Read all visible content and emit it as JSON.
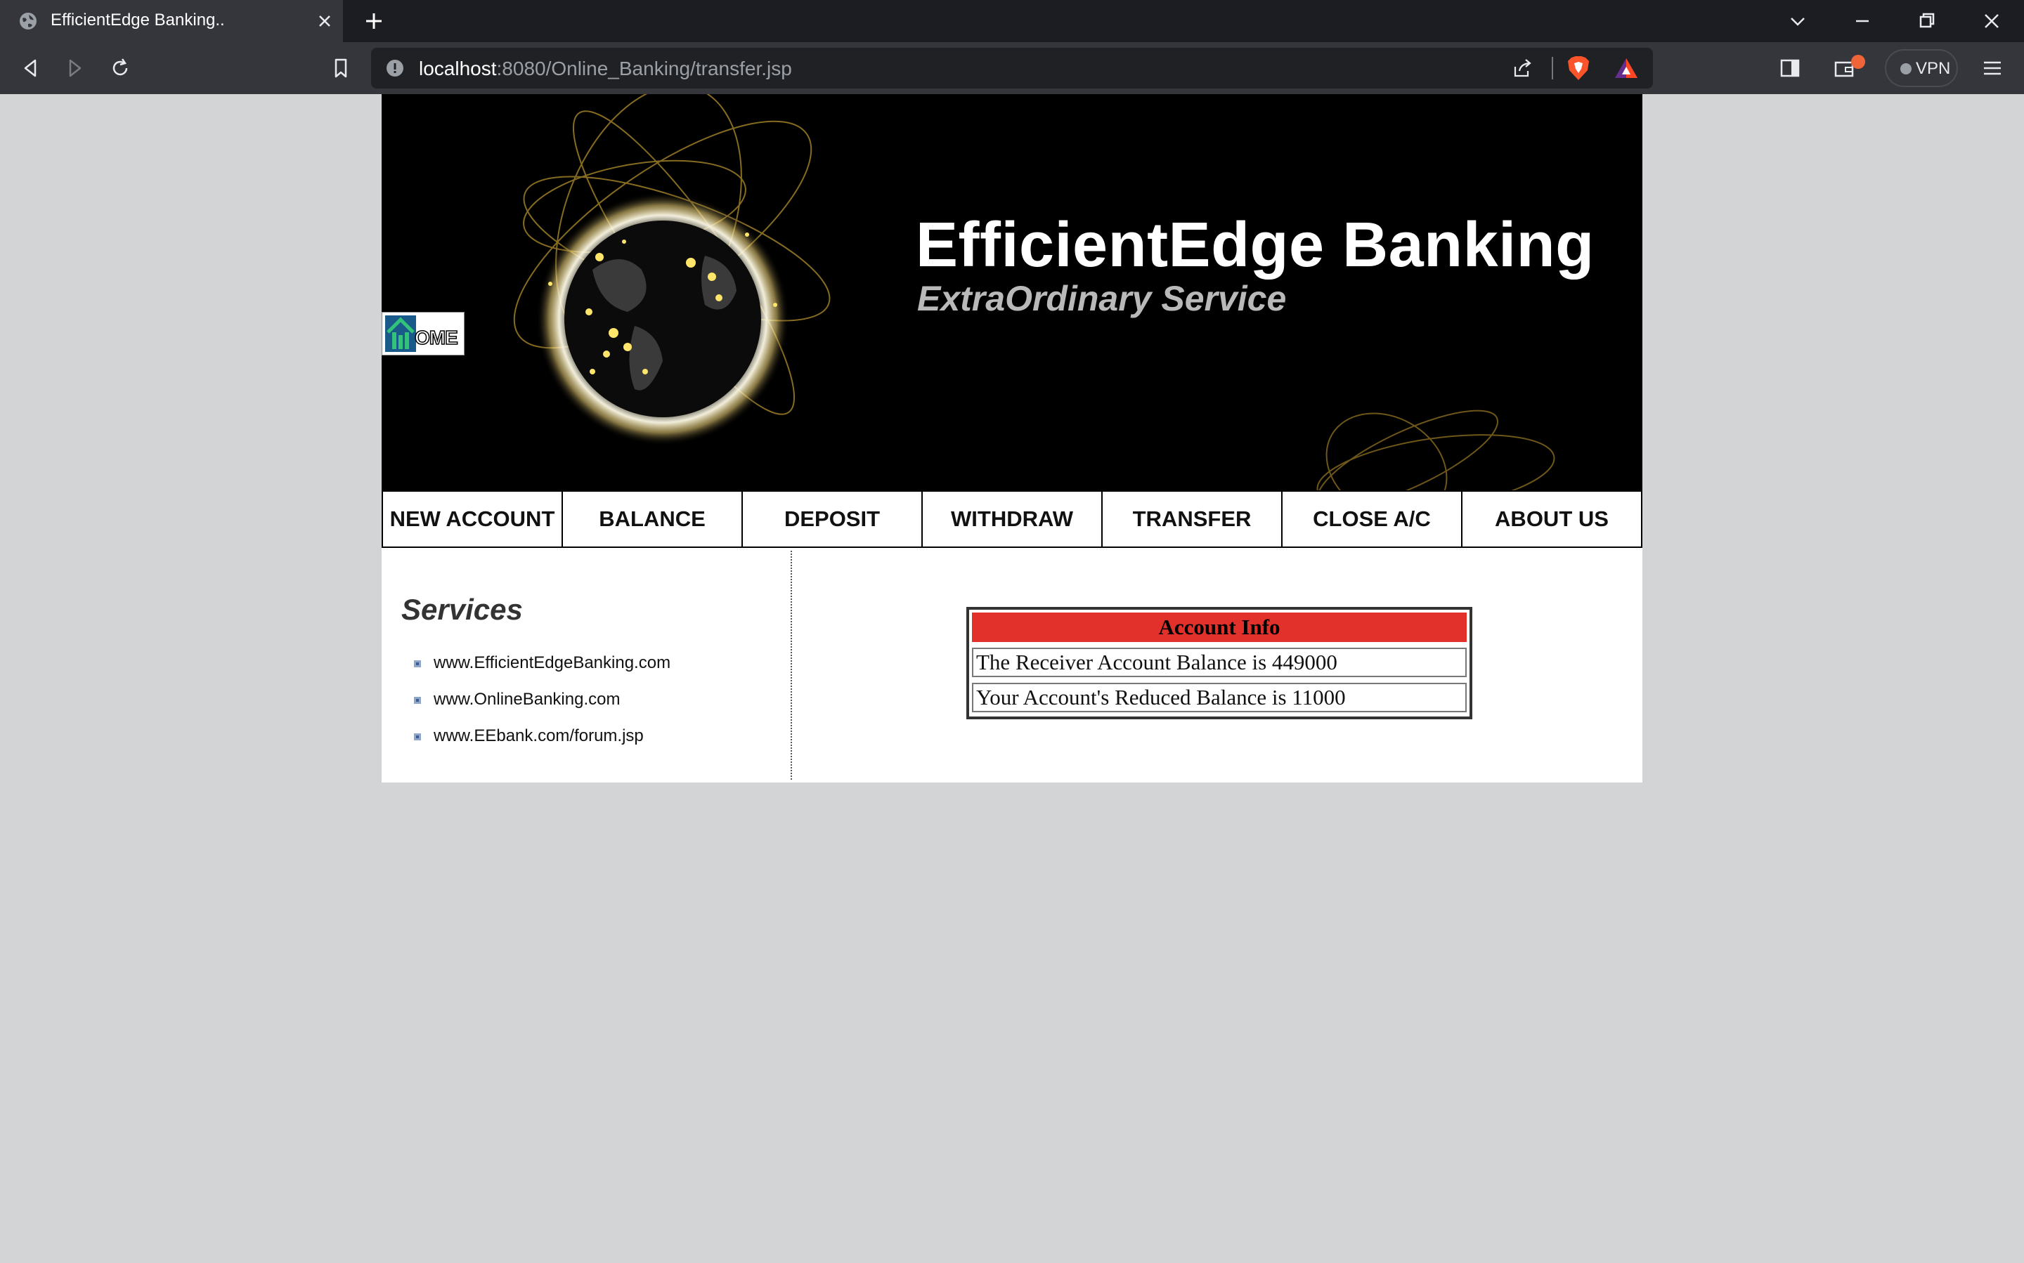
{
  "browser": {
    "tab_title": "EfficientEdge Banking..",
    "url_host": "localhost",
    "url_rest": ":8080/Online_Banking/transfer.jsp",
    "vpn_label": "VPN"
  },
  "banner": {
    "title": "EfficientEdge Banking",
    "tagline": "ExtraOrdinary Service",
    "home_label": "OME"
  },
  "nav": [
    "NEW ACCOUNT",
    "BALANCE",
    "DEPOSIT",
    "WITHDRAW",
    "TRANSFER",
    "CLOSE A/C",
    "ABOUT US"
  ],
  "sidebar": {
    "title": "Services",
    "links": [
      "www.EfficientEdgeBanking.com",
      "www.OnlineBanking.com",
      "www.EEbank.com/forum.jsp"
    ]
  },
  "account_info": {
    "header": "Account Info",
    "rows": [
      "The Receiver Account Balance is 449000",
      "Your Account's Reduced Balance is 11000"
    ]
  },
  "colors": {
    "header_red": "#e2312a",
    "browser_dark": "#1c1d22",
    "page_bg": "#d3d4d6"
  }
}
